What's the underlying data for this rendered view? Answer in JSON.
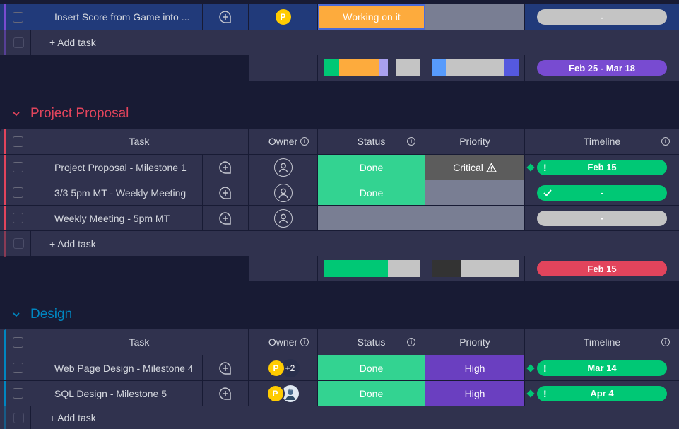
{
  "headers": {
    "task": "Task",
    "owner": "Owner",
    "status": "Status",
    "priority": "Priority",
    "timeline": "Timeline"
  },
  "add_task": "+ Add task",
  "group0": {
    "accent": "#784bd1",
    "row": {
      "task": "Insert Score from Game into ...",
      "owner_initial": "P",
      "status": "Working on it",
      "status_color": "#fdab3d",
      "priority": "",
      "timeline": "-"
    },
    "summary": {
      "timeline": "Feb 25 - Mar 18",
      "timeline_color": "#784bd1"
    }
  },
  "group1": {
    "title": "Project Proposal",
    "color": "#e2445c",
    "rows": [
      {
        "task": "Project Proposal - Milestone 1",
        "status": "Done",
        "priority": "Critical",
        "timeline": "Feb 15",
        "timeline_icon": "exclamation"
      },
      {
        "task": "3/3 5pm MT - Weekly Meeting",
        "status": "Done",
        "priority": "",
        "timeline": "-",
        "timeline_icon": "check"
      },
      {
        "task": "Weekly Meeting - 5pm MT",
        "status": "",
        "priority": "",
        "timeline": "-",
        "timeline_icon": ""
      }
    ],
    "summary": {
      "timeline": "Feb 15",
      "timeline_color": "#e2445c"
    }
  },
  "group2": {
    "title": "Design",
    "color": "#0086c0",
    "rows": [
      {
        "task": "Web Page Design - Milestone 4",
        "owner_initial": "P",
        "owner_extra": "+2",
        "status": "Done",
        "priority": "High",
        "timeline": "Mar 14"
      },
      {
        "task": "SQL Design - Milestone 5",
        "owner_initial": "P",
        "status": "Done",
        "priority": "High",
        "timeline": "Apr 4"
      }
    ]
  },
  "colors": {
    "done": "#33d391",
    "working": "#fdab3d",
    "empty": "#797e93",
    "critical": "#5c5c5c",
    "high": "#6a3fc0",
    "timeline_green": "#00c875",
    "timeline_grey": "#c4c4c4"
  }
}
